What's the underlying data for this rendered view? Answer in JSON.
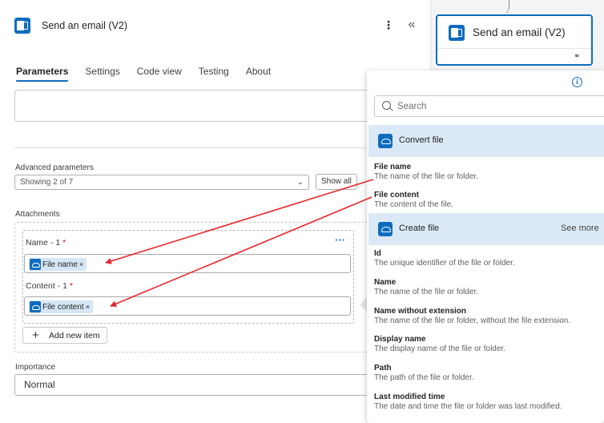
{
  "header": {
    "title": "Send an email (V2)",
    "more_glyph": "⋮",
    "collapse_glyph": "«"
  },
  "tabs": [
    {
      "label": "Parameters",
      "active": true
    },
    {
      "label": "Settings",
      "active": false
    },
    {
      "label": "Code view",
      "active": false
    },
    {
      "label": "Testing",
      "active": false
    },
    {
      "label": "About",
      "active": false
    }
  ],
  "advanced": {
    "label": "Advanced parameters",
    "value": "Showing 2 of 7",
    "show_all_label": "Show all"
  },
  "attachments": {
    "label": "Attachments",
    "name_label": "Name - 1",
    "content_label": "Content - 1",
    "required_mark": "*",
    "name_token": "File name",
    "content_token": "File content",
    "token_remove": "×",
    "add_item_label": "Add new item",
    "more_glyph": "···"
  },
  "importance": {
    "label": "Importance",
    "value": "Normal"
  },
  "canvas": {
    "card_title": "Send an email (V2)"
  },
  "dynamic_content": {
    "search_placeholder": "Search",
    "sections": [
      {
        "title": "Convert file",
        "items": [
          {
            "name": "File name",
            "desc": "The name of the file or folder."
          },
          {
            "name": "File content",
            "desc": "The content of the file."
          }
        ]
      },
      {
        "title": "Create file",
        "see_more": "See more",
        "items": [
          {
            "name": "Id",
            "desc": "The unique identifier of the file or folder."
          },
          {
            "name": "Name",
            "desc": "The name of the file or folder."
          },
          {
            "name": "Name without extension",
            "desc": "The name of the file or folder, without the file extension."
          },
          {
            "name": "Display name",
            "desc": "The display name of the file or folder."
          },
          {
            "name": "Path",
            "desc": "The path of the file or folder."
          },
          {
            "name": "Last modified time",
            "desc": "The date and time the file or folder was last modified."
          }
        ]
      }
    ]
  },
  "colors": {
    "accent": "#0f6cbd",
    "annotation_arrow": "#e8252b",
    "section_bg": "#dbe9f6",
    "token_bg": "#d6e6f5"
  },
  "icons": [
    "outlook-icon",
    "info-icon",
    "search-icon",
    "onedrive-icon",
    "link-icon",
    "plus-icon",
    "chevron-down-icon"
  ]
}
